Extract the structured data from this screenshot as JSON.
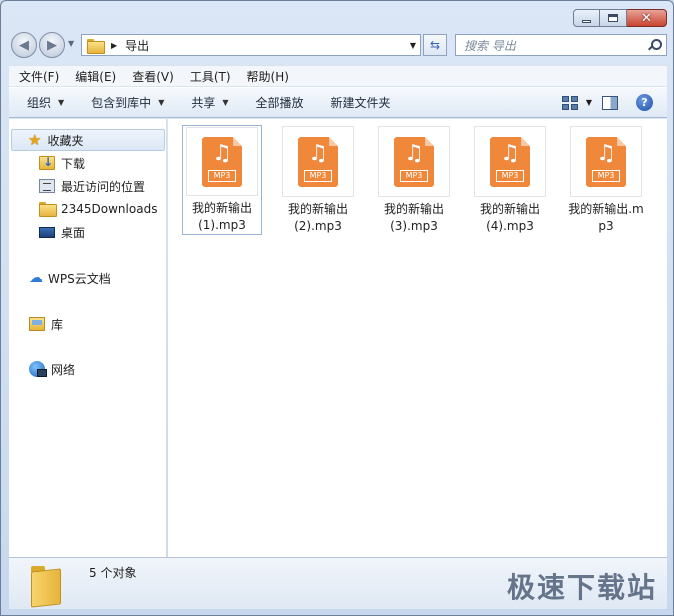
{
  "navigation": {
    "address_text": "导出",
    "search_placeholder": "搜索 导出"
  },
  "menu": {
    "items": [
      "文件(F)",
      "编辑(E)",
      "查看(V)",
      "工具(T)",
      "帮助(H)"
    ]
  },
  "toolbar": {
    "organize": "组织",
    "include_in_library": "包含到库中",
    "share": "共享",
    "play_all": "全部播放",
    "new_folder": "新建文件夹"
  },
  "nav_pane": {
    "favorites": "收藏夹",
    "downloads": "下载",
    "recent_places": "最近访问的位置",
    "downloads_2345": "2345Downloads",
    "desktop": "桌面",
    "wps_cloud": "WPS云文档",
    "libraries": "库",
    "network": "网络"
  },
  "files": [
    {
      "name": "我的新输出(1).mp3",
      "type_label": "MP3"
    },
    {
      "name": "我的新输出(2).mp3",
      "type_label": "MP3"
    },
    {
      "name": "我的新输出(3).mp3",
      "type_label": "MP3"
    },
    {
      "name": "我的新输出(4).mp3",
      "type_label": "MP3"
    },
    {
      "name": "我的新输出.mp3",
      "type_label": "MP3"
    }
  ],
  "status": {
    "item_count": "5 个对象"
  },
  "watermark": "极速下载站",
  "colors": {
    "mp3_icon": "#f0883c",
    "frame": "#cfdcec"
  },
  "icons": {
    "caption": [
      "minimize-icon",
      "maximize-icon",
      "close-icon"
    ],
    "nav": [
      "back-arrow-icon",
      "forward-arrow-icon",
      "folder-icon",
      "refresh-icon",
      "search-icon"
    ]
  }
}
